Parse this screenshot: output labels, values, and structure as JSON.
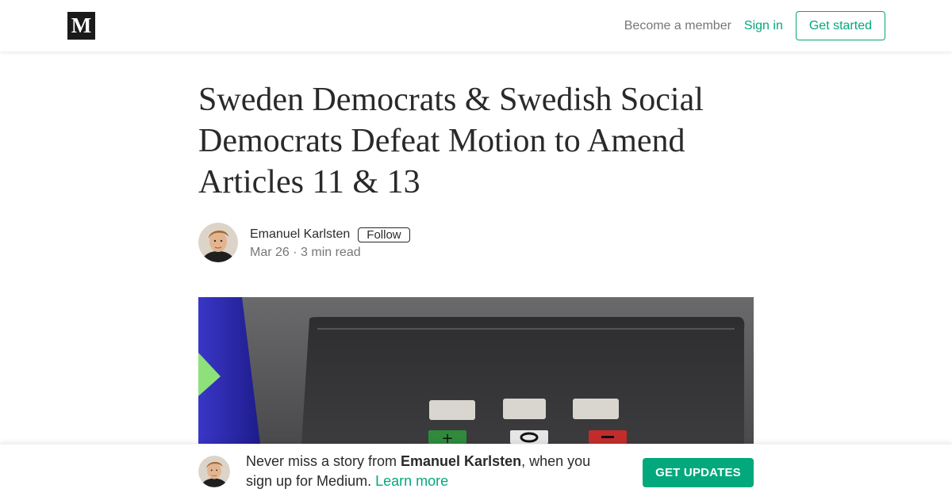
{
  "header": {
    "logo_text": "M",
    "become_member_label": "Become a member",
    "sign_in_label": "Sign in",
    "get_started_label": "Get started"
  },
  "article": {
    "title": "Sweden Democrats & Swedish Social Democrats Defeat Motion to Amend Articles 11 & 13",
    "author_name": "Emanuel Karlsten",
    "follow_label": "Follow",
    "date": "Mar 26",
    "separator": "·",
    "read_time": "3 min read"
  },
  "footer": {
    "prefix_text": "Never miss a story from ",
    "author_name": "Emanuel Karlsten",
    "suffix_text": ", when you sign up for Medium.",
    "learn_more_label": "Learn more",
    "cta_label": "GET UPDATES"
  },
  "colors": {
    "accent_green": "#03a87c",
    "logo_bg": "#1a1a1a",
    "text_primary": "rgba(0,0,0,0.84)",
    "text_secondary": "rgba(0,0,0,0.54)"
  },
  "icons": {
    "logo": "medium-logo-icon",
    "author_avatar": "author-avatar",
    "hero_image": "voting-machine-photo"
  }
}
